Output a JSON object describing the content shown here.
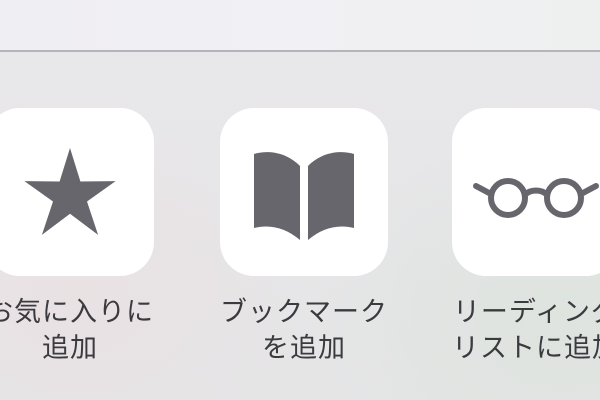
{
  "share_sheet": {
    "actions": [
      {
        "icon": "star-icon",
        "label_line1": "お気に入りに",
        "label_line2": "追加"
      },
      {
        "icon": "book-icon",
        "label_line1": "ブックマーク",
        "label_line2": "を追加"
      },
      {
        "icon": "glasses-icon",
        "label_line1": "リーディング",
        "label_line2": "リストに追加"
      }
    ]
  },
  "colors": {
    "icon_gray": "#67666c",
    "label_text": "#3b3a3f",
    "tile_bg": "#ffffff"
  }
}
